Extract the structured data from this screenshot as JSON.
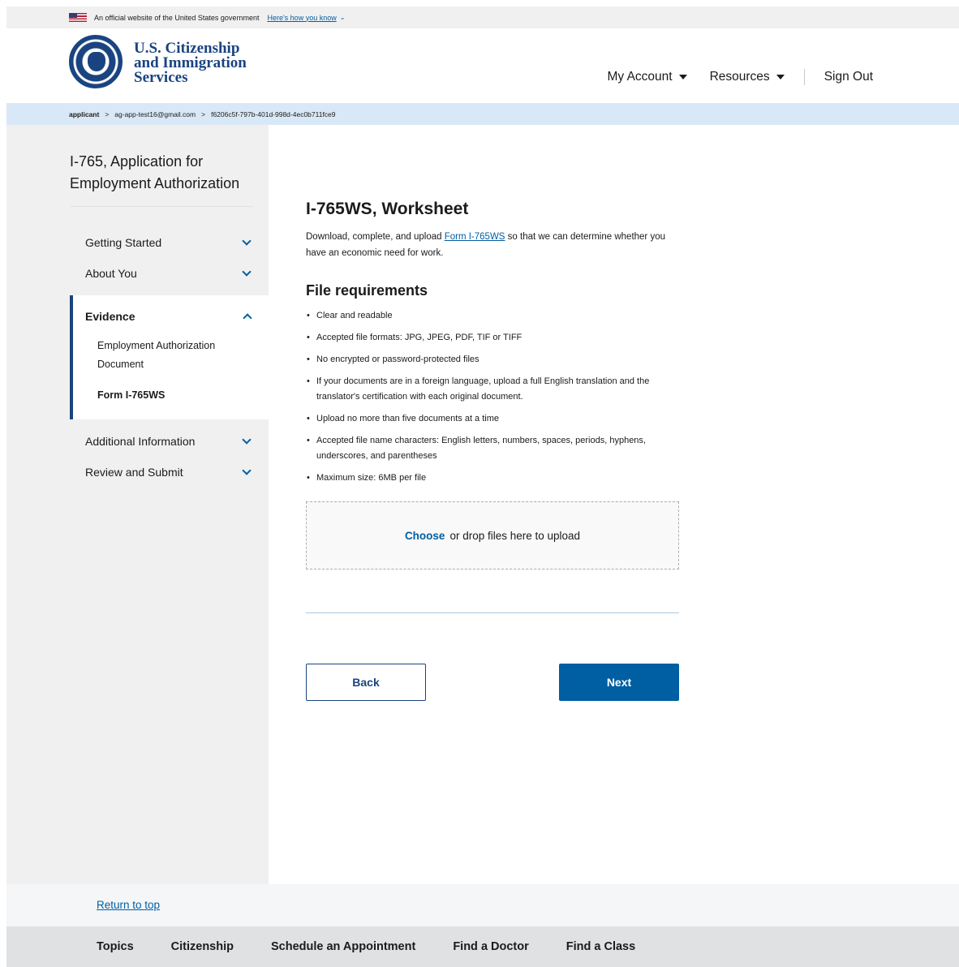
{
  "banner": {
    "text": "An official website of the United States government",
    "link": "Here's how you know",
    "caret": "⌄"
  },
  "header": {
    "logo_line1": "U.S. Citizenship",
    "logo_line2": "and Immigration",
    "logo_line3": "Services",
    "nav": {
      "my_account": "My Account",
      "resources": "Resources",
      "sign_out": "Sign Out"
    }
  },
  "breadcrumb": {
    "items": [
      "applicant",
      "ag-app-test16@gmail.com",
      "f6206c5f-797b-401d-998d-4ec0b711fce9"
    ],
    "separator": ">"
  },
  "sidebar": {
    "title": "I-765, Application for Employment Authorization",
    "items": [
      {
        "label": "Getting Started"
      },
      {
        "label": "About You"
      },
      {
        "label": "Evidence"
      },
      {
        "label": "Additional Information"
      },
      {
        "label": "Review and Submit"
      }
    ],
    "evidence_subitems": [
      {
        "label": "Employment Authorization Document"
      },
      {
        "label": "Form I-765WS"
      }
    ]
  },
  "main": {
    "heading": "I-765WS, Worksheet",
    "intro_before": "Download, complete, and upload ",
    "intro_link": "Form I-765WS",
    "intro_after": " so that we can determine whether you have an economic need for work.",
    "requirements_heading": "File requirements",
    "requirements": [
      "Clear and readable",
      "Accepted file formats: JPG, JPEG, PDF, TIF or TIFF",
      "No encrypted or password-protected files",
      "If your documents are in a foreign language, upload a full English translation and the translator's certification with each original document.",
      "Upload no more than five documents at a time",
      "Accepted file name characters: English letters, numbers, spaces, periods, hyphens, underscores, and parentheses",
      "Maximum size: 6MB per file"
    ],
    "dropzone_choose": "Choose",
    "dropzone_text": "or drop files here to upload",
    "back_label": "Back",
    "next_label": "Next"
  },
  "footer": {
    "return_to_top": "Return to top",
    "links": [
      "Topics",
      "Citizenship",
      "Schedule an Appointment",
      "Find a Doctor",
      "Find a Class"
    ]
  },
  "colors": {
    "primary": "#005ea2",
    "dark_blue": "#1a4480",
    "breadcrumb_bg": "#d9e8f6",
    "sidebar_bg": "#f0f0f0"
  }
}
